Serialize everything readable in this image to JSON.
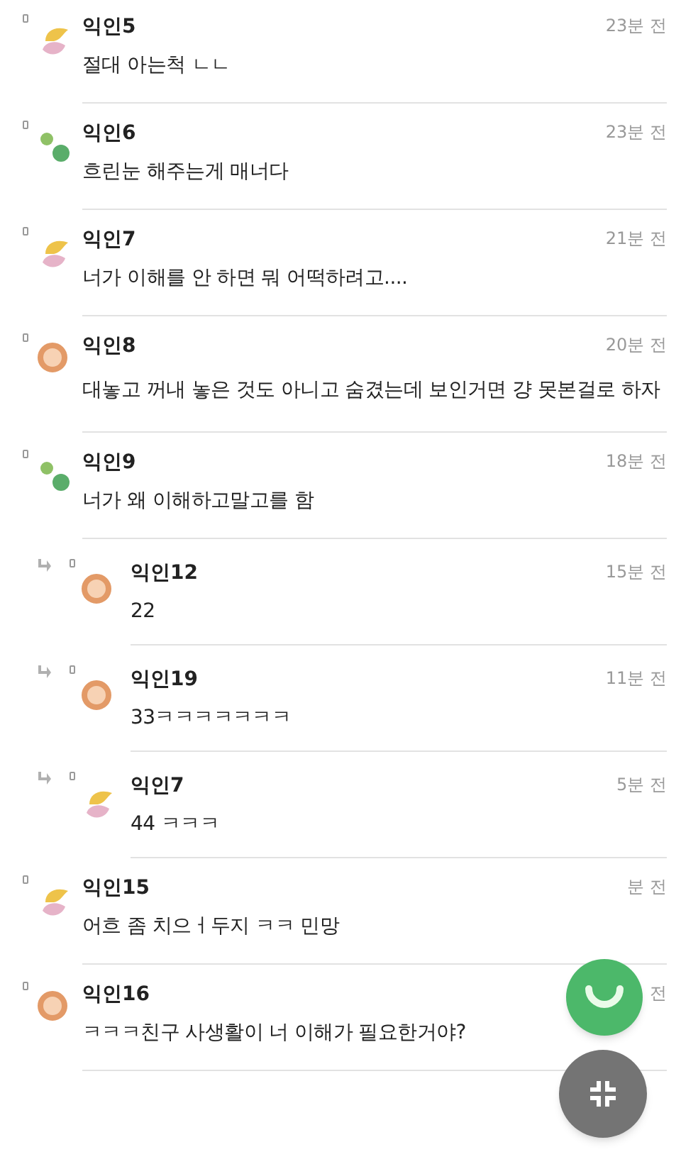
{
  "comments": [
    {
      "name": "익인5",
      "kind": "sun",
      "time": "23분 전",
      "text": "절대 아는척 ㄴㄴ"
    },
    {
      "name": "익인6",
      "kind": "dots",
      "time": "23분 전",
      "text": "흐린눈 해주는게 매너다"
    },
    {
      "name": "익인7",
      "kind": "sun",
      "time": "21분 전",
      "text": "너가 이해를 안 하면 뭐 어떡하려고...."
    },
    {
      "name": "익인8",
      "kind": "ring",
      "time": "20분 전",
      "text": "대놓고 꺼내 놓은 것도 아니고 숨겼는데 보인거면 걍 못본걸로 하자"
    },
    {
      "name": "익인9",
      "kind": "dots",
      "time": "18분 전",
      "text": "너가 왜 이해하고말고를 함",
      "children": [
        {
          "name": "익인12",
          "kind": "ring",
          "time": "15분 전",
          "text": "22"
        },
        {
          "name": "익인19",
          "kind": "ring",
          "time": "11분 전",
          "text": "33ㅋㅋㅋㅋㅋㅋㅋ"
        },
        {
          "name": "익인7",
          "kind": "sun",
          "time": "5분 전",
          "text": "44 ㅋㅋㅋ"
        }
      ]
    },
    {
      "name": "익인15",
      "kind": "sun",
      "time": "분 전",
      "text": "어흐 좀 치으ㅓ두지 ㅋㅋ 민망"
    },
    {
      "name": "익인16",
      "kind": "ring",
      "time": "전",
      "text": "ㅋㅋㅋ친구 사생활이 너 이해가 필요한거야?"
    }
  ]
}
